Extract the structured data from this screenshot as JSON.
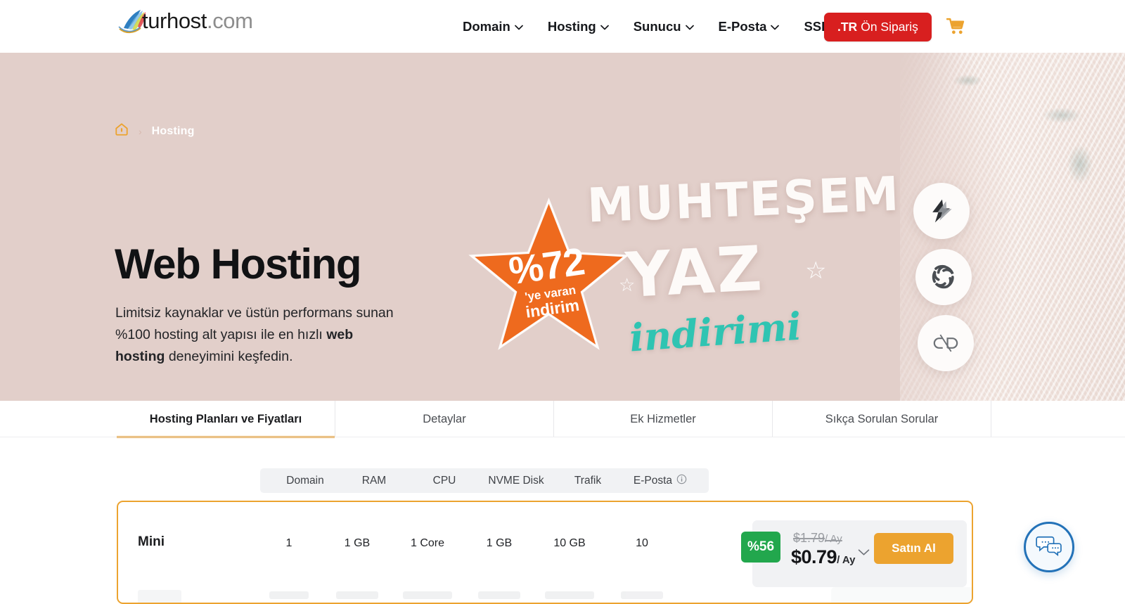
{
  "header": {
    "logo": {
      "primary": "turhost",
      "suffix": ".com",
      "icon": "turhost-logo-icon"
    },
    "nav": [
      {
        "label": "Domain",
        "icon": "chevron-down-icon"
      },
      {
        "label": "Hosting",
        "icon": "chevron-down-icon"
      },
      {
        "label": "Sunucu",
        "icon": "chevron-down-icon"
      },
      {
        "label": "E-Posta",
        "icon": "chevron-down-icon"
      },
      {
        "label": "SSL",
        "icon": "chevron-down-icon"
      }
    ],
    "tr_button": {
      "prefix": ".TR",
      "label": "Ön Sipariş",
      "color": "#d81f1f"
    },
    "cart": {
      "icon": "shopping-cart-icon",
      "color": "#eca32f"
    }
  },
  "breadcrumb": {
    "home_icon": "home-icon",
    "separator": "›",
    "current": "Hosting"
  },
  "hero": {
    "title": "Web Hosting",
    "subtitle_part1": "Limitsiz kaynaklar ve üstün performans sunan %100 hosting alt yapısı ile en hızlı ",
    "subtitle_bold": "web hosting",
    "subtitle_part2": " deneyimini keşfedin.",
    "background_color": "#e2cfca",
    "promo": {
      "word1": "MUHTEŞEM",
      "word2": "YAZ",
      "word3": "indirimi",
      "star_percent": "%72",
      "star_line1": "'ye varan",
      "star_line2": "indirim",
      "star_color": "#ee6a1e",
      "script_color": "#2fc4b2"
    },
    "tech_badges": [
      {
        "name": "litespeed-icon"
      },
      {
        "name": "imunify360-icon"
      },
      {
        "name": "cpanel-icon"
      }
    ]
  },
  "tabs": {
    "active_index": 0,
    "accent": "#e8a33d",
    "items": [
      {
        "label": "Hosting Planları ve Fiyatları"
      },
      {
        "label": "Detaylar"
      },
      {
        "label": "Ek Hizmetler"
      },
      {
        "label": "Sıkça Sorulan Sorular"
      }
    ]
  },
  "pricing_table": {
    "columns": [
      {
        "label": "Domain",
        "info": false
      },
      {
        "label": "RAM",
        "info": false
      },
      {
        "label": "CPU",
        "info": false
      },
      {
        "label": "NVME Disk",
        "info": false
      },
      {
        "label": "Trafik",
        "info": false
      },
      {
        "label": "E-Posta",
        "info": true,
        "info_icon": "info-icon"
      }
    ],
    "rows": [
      {
        "name": "Mini",
        "domain": "1",
        "ram": "1 GB",
        "cpu": "1 Core",
        "disk": "1 GB",
        "traffic": "10 GB",
        "email": "10",
        "discount_badge": "%56",
        "old_price": "$1.79",
        "old_price_period": "/ Ay",
        "new_price": "$0.79",
        "new_price_period": "/ Ay",
        "buy_label": "Satın Al",
        "expand_icon": "chevron-down-icon",
        "badge_color": "#22a74d",
        "buy_color": "#eca32f"
      }
    ]
  },
  "chat_widget": {
    "icon": "chat-bubbles-icon",
    "color": "#2372b8"
  }
}
